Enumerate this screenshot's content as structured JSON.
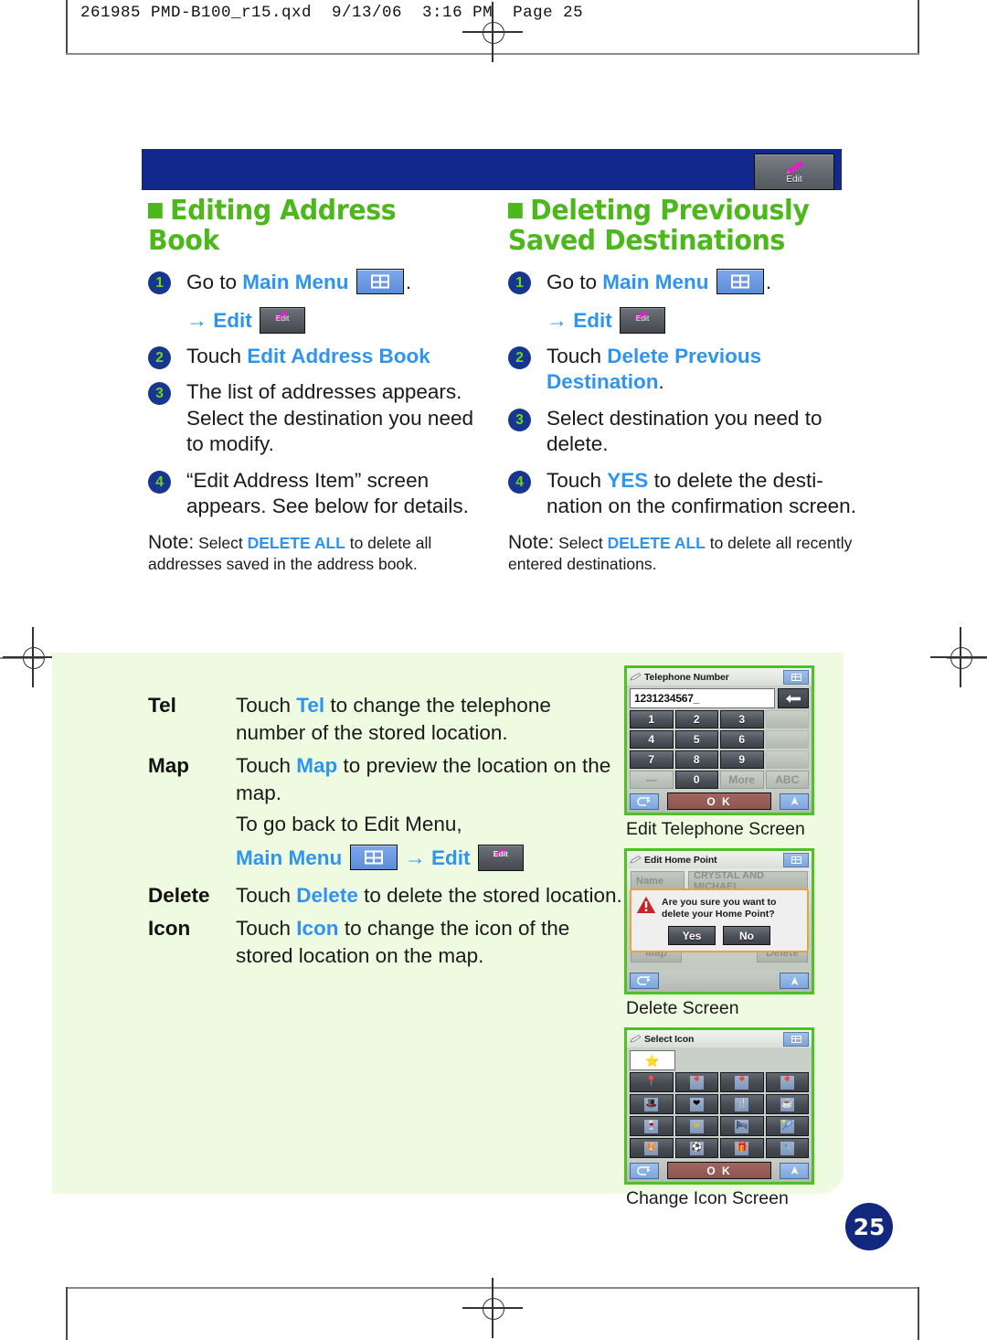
{
  "printer_header": "261985 PMD-B100_r15.qxd  9/13/06  3:16 PM  Page 25",
  "banner": {
    "edit_button_label": "Edit"
  },
  "page_number": "25",
  "left_column": {
    "heading": "Editing Address Book",
    "steps": [
      {
        "num": "1",
        "pre": "Go to ",
        "link": "Main Menu",
        "post": ".",
        "sub_arrow": "→",
        "sub_link": "Edit"
      },
      {
        "num": "2",
        "pre": "Touch ",
        "link": "Edit Address Book",
        "post": ""
      },
      {
        "num": "3",
        "text": "The list of addresses appears. Select the destination you need to modify."
      },
      {
        "num": "4",
        "text": "“Edit Address Item” screen appears. See below for details."
      }
    ],
    "note": {
      "lead": "Note:",
      "pre": " Select ",
      "highlight": "DELETE ALL",
      "post": " to delete all addresses saved in the address book."
    }
  },
  "right_column": {
    "heading": "Deleting Previously Saved Destinations",
    "steps": [
      {
        "num": "1",
        "pre": "Go to ",
        "link": "Main Menu",
        "post": ".",
        "sub_arrow": "→",
        "sub_link": "Edit"
      },
      {
        "num": "2",
        "pre": "Touch ",
        "link": "Delete Previous Destination",
        "post": "."
      },
      {
        "num": "3",
        "text": "Select destination you need to delete."
      },
      {
        "num": "4",
        "pre": "Touch ",
        "link": "YES",
        "post": " to delete the desti-nation on the confirmation screen."
      }
    ],
    "note": {
      "lead": "Note:",
      "pre": " Select ",
      "highlight": "DELETE ALL",
      "post": " to delete all recently entered destinations."
    }
  },
  "descriptions": [
    {
      "term": "Tel",
      "pre": "Touch ",
      "link": "Tel",
      "post": " to change the telephone number of the stored location."
    },
    {
      "term": "Map",
      "pre": "Touch ",
      "link": "Map",
      "post": " to preview the location on the map."
    },
    {
      "term": "Delete",
      "pre": "Touch ",
      "link": "Delete",
      "post": " to delete the stored location."
    },
    {
      "term": "Icon",
      "pre": "Touch ",
      "link": "Icon",
      "post": " to change the icon of the stored location on the map."
    }
  ],
  "go_back": {
    "text": "To go back to Edit Menu,",
    "main_menu": "Main Menu",
    "arrow": "→",
    "edit": "Edit"
  },
  "screens": {
    "telephone": {
      "title": "Telephone Number",
      "input_value": "1231234567_",
      "keys": [
        "1",
        "2",
        "3",
        "",
        "4",
        "5",
        "6",
        "",
        "7",
        "8",
        "9",
        "",
        "—",
        "0",
        "More",
        "ABC"
      ],
      "ok_label": "O K",
      "caption": "Edit Telephone Screen"
    },
    "delete": {
      "title": "Edit Home Point",
      "field_label": "Name",
      "field_value": "CRYSTAL AND MICHAEL",
      "dialog_text": "Are you sure you want to delete your Home Point?",
      "yes_label": "Yes",
      "no_label": "No",
      "map_label": "Map",
      "delete_label": "Delete",
      "caption": "Delete Screen"
    },
    "icon": {
      "title": "Select Icon",
      "selected_icon": "star-icon",
      "grid_icons": [
        "pin-yellow-icon",
        "pin-blue-icon",
        "pin-red-icon",
        "pin-purple-icon",
        "cap-icon",
        "heart-icon",
        "cutlery-icon",
        "coffee-cup-icon",
        "bottle-icon",
        "star-icon",
        "chair-icon",
        "racket-icon",
        "palette-icon",
        "soccer-ball-icon",
        "gift-icon",
        "wrench-icon"
      ],
      "ok_label": "O K",
      "caption": "Change Icon Screen"
    }
  },
  "colors": {
    "heading_green": "#4cb81b",
    "link_blue": "#2e94f0",
    "banner_blue": "#13288c",
    "panel_green": "#eefbe0",
    "step_circle": "#16368f",
    "step_number": "#72d41a"
  }
}
